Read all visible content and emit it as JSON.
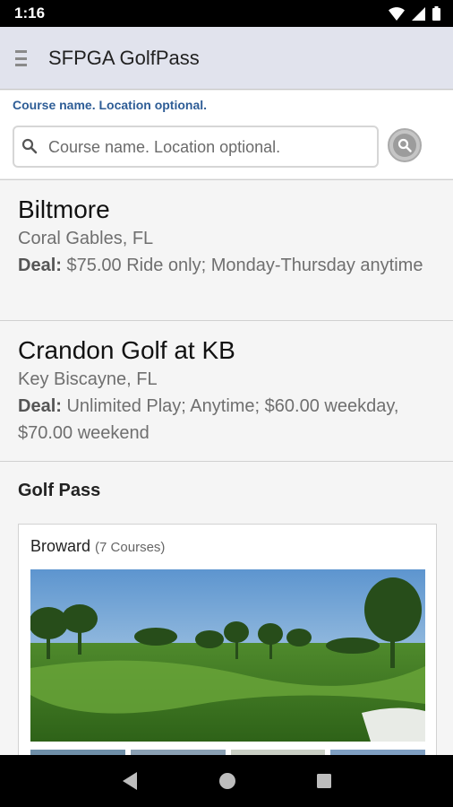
{
  "status_bar": {
    "time": "1:16"
  },
  "app_bar": {
    "title": "SFPGA GolfPass",
    "menu_icon": "hamburger-menu-icon"
  },
  "search": {
    "caption": "Course name. Location optional.",
    "placeholder": "Course name. Location optional.",
    "value": ""
  },
  "courses": [
    {
      "name": "Biltmore",
      "location": "Coral Gables, FL",
      "deal_label": "Deal:",
      "deal_text": "$75.00 Ride only; Monday-Thursday anytime"
    },
    {
      "name": "Crandon Golf at KB",
      "location": "Key Biscayne, FL",
      "deal_label": "Deal:",
      "deal_text": "Unlimited Play; Anytime; $60.00 weekday, $70.00 weekend"
    }
  ],
  "golf_pass": {
    "title": "Golf Pass",
    "regions": [
      {
        "name": "Broward",
        "count_label": "(7 Courses)"
      }
    ]
  },
  "colors": {
    "accent_caption": "#2e5d96",
    "app_bar_bg": "#e1e3ed"
  }
}
